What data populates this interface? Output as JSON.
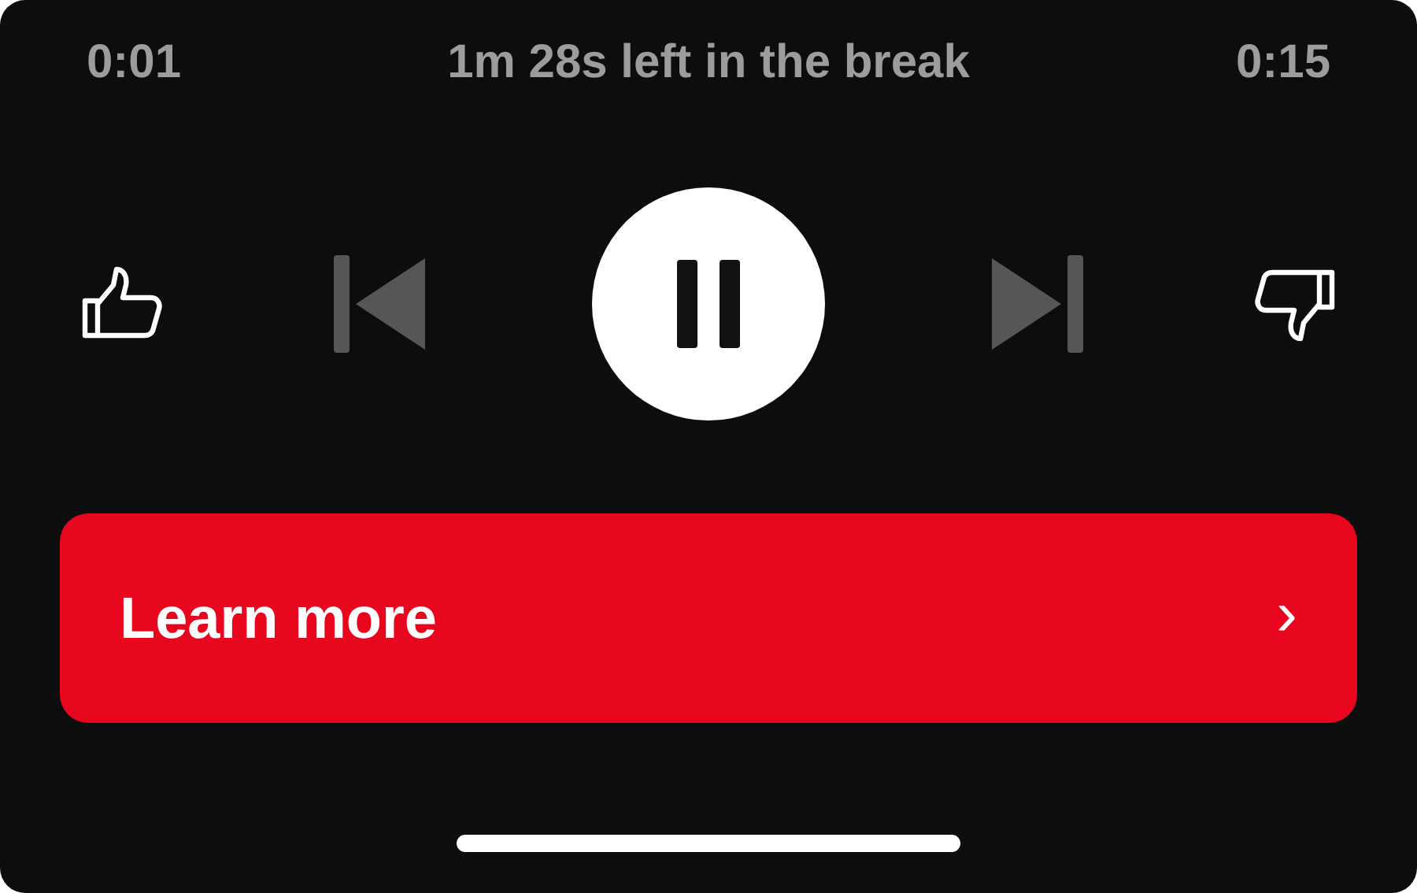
{
  "progress": {
    "elapsed": "0:01",
    "message": "1m 28s left in the break",
    "total": "0:15"
  },
  "controls": [
    {
      "kind": "like",
      "disabled": false
    },
    {
      "kind": "previous",
      "disabled": true
    },
    {
      "kind": "playpause",
      "playing": true
    },
    {
      "kind": "next",
      "disabled": true
    },
    {
      "kind": "dislike",
      "disabled": false
    }
  ],
  "action": {
    "label": "Learn more",
    "chevron": "›"
  }
}
